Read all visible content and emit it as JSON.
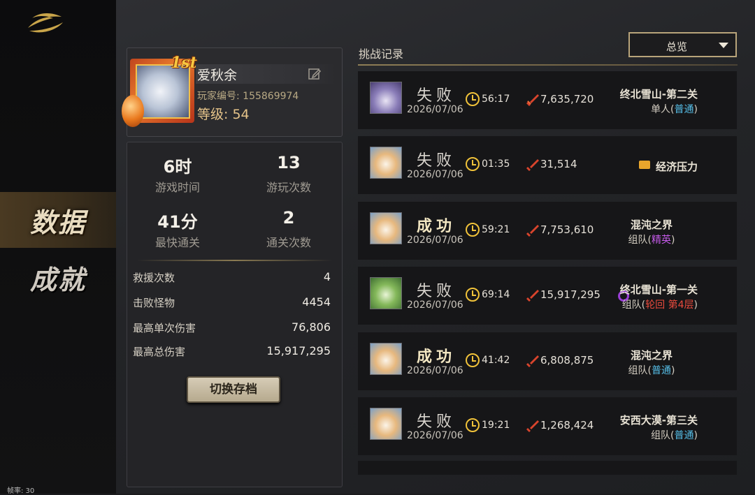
{
  "sidebar": {
    "items": [
      {
        "label": "数据"
      },
      {
        "label": "成就"
      }
    ],
    "fps_label": "帧率: 30"
  },
  "profile": {
    "rank_badge": "1st",
    "name": "爱秋余",
    "player_id": "玩家编号: 155869974",
    "level": "等级: 54"
  },
  "stats": {
    "play_time_value": "6时",
    "play_time_label": "游戏时间",
    "play_count_value": "13",
    "play_count_label": "游玩次数",
    "fastest_clear_value": "41分",
    "fastest_clear_label": "最快通关",
    "clear_count_value": "2",
    "clear_count_label": "通关次数",
    "rows": [
      {
        "label": "救援次数",
        "value": "4"
      },
      {
        "label": "击败怪物",
        "value": "4454"
      },
      {
        "label": "最高单次伤害",
        "value": "76,806"
      },
      {
        "label": "最高总伤害",
        "value": "15,917,295"
      }
    ],
    "switch_button": "切换存档"
  },
  "records": {
    "title": "挑战记录",
    "filter": {
      "selected": "总览"
    },
    "items": [
      {
        "result": "失败",
        "date": "2026/07/06",
        "time": "56:17",
        "damage": "7,635,720",
        "stage": "终北雪山-第二关",
        "mode_prefix": "单人(",
        "mode_type": "普通",
        "mode_suffix": ")"
      },
      {
        "result": "失败",
        "date": "2026/07/06",
        "time": "01:35",
        "damage": "31,514",
        "stage": "经济压力"
      },
      {
        "result": "成功",
        "date": "2026/07/06",
        "time": "59:21",
        "damage": "7,753,610",
        "stage": "混沌之界",
        "mode_prefix": "组队(",
        "mode_type": "精英",
        "mode_suffix": ")"
      },
      {
        "result": "失败",
        "date": "2026/07/06",
        "time": "69:14",
        "damage": "15,917,295",
        "stage": "终北雪山-第一关",
        "mode_prefix": "组队(",
        "mode_type": "轮回",
        "mode_extra": "第4层",
        "mode_suffix": ")"
      },
      {
        "result": "成功",
        "date": "2026/07/06",
        "time": "41:42",
        "damage": "6,808,875",
        "stage": "混沌之界",
        "mode_prefix": "组队(",
        "mode_type": "普通",
        "mode_suffix": ")"
      },
      {
        "result": "失败",
        "date": "2026/07/06",
        "time": "19:21",
        "damage": "1,268,424",
        "stage": "安西大漠-第三关",
        "mode_prefix": "组队(",
        "mode_type": "普通",
        "mode_suffix": ")"
      }
    ]
  },
  "colors": {
    "accent_gold": "#b8a47a",
    "mode_normal": "#55bde6",
    "mode_elite": "#c45ae8",
    "mode_cycle": "#e94a3c"
  }
}
